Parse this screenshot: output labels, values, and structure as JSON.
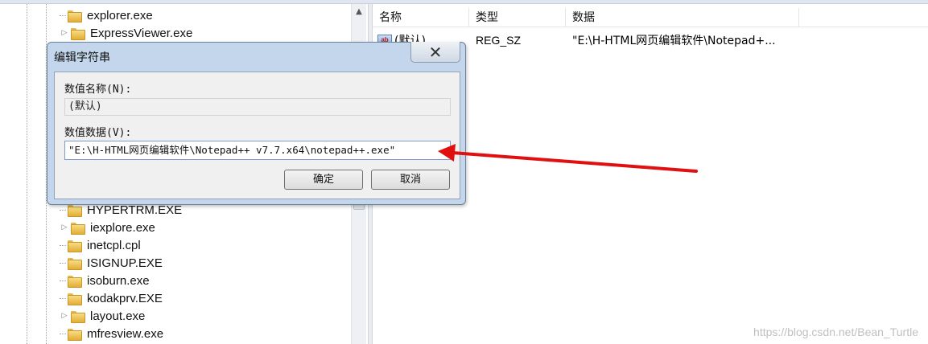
{
  "tree": {
    "items": [
      {
        "label": "explorer.exe",
        "expandable": false
      },
      {
        "label": "ExpressViewer.exe",
        "expandable": true
      },
      {
        "label": "HYPERTRM.EXE",
        "expandable": false
      },
      {
        "label": "iexplore.exe",
        "expandable": true
      },
      {
        "label": "inetcpl.cpl",
        "expandable": false
      },
      {
        "label": "ISIGNUP.EXE",
        "expandable": false
      },
      {
        "label": "isoburn.exe",
        "expandable": false
      },
      {
        "label": "kodakprv.EXE",
        "expandable": false
      },
      {
        "label": "layout.exe",
        "expandable": true
      },
      {
        "label": "mfresview.exe",
        "expandable": false
      }
    ]
  },
  "list": {
    "headers": {
      "name": "名称",
      "type": "类型",
      "data": "数据"
    },
    "rows": [
      {
        "icon": "ab",
        "name": "(默认)",
        "type": "REG_SZ",
        "data": "\"E:\\H-HTML网页编辑软件\\Notepad+..."
      }
    ]
  },
  "dialog": {
    "title": "编辑字符串",
    "close_glyph": "✕",
    "value_name_label": "数值名称(N):",
    "value_name": "(默认)",
    "value_data_label": "数值数据(V):",
    "value_data": "\"E:\\H-HTML网页编辑软件\\Notepad++ v7.7.x64\\notepad++.exe\"",
    "ok_label": "确定",
    "cancel_label": "取消"
  },
  "watermark": "https://blog.csdn.net/Bean_Turtle",
  "colors": {
    "annotation_arrow": "#e01010",
    "dialog_frame": "#c3d6ec",
    "folder": "#e8b840"
  }
}
